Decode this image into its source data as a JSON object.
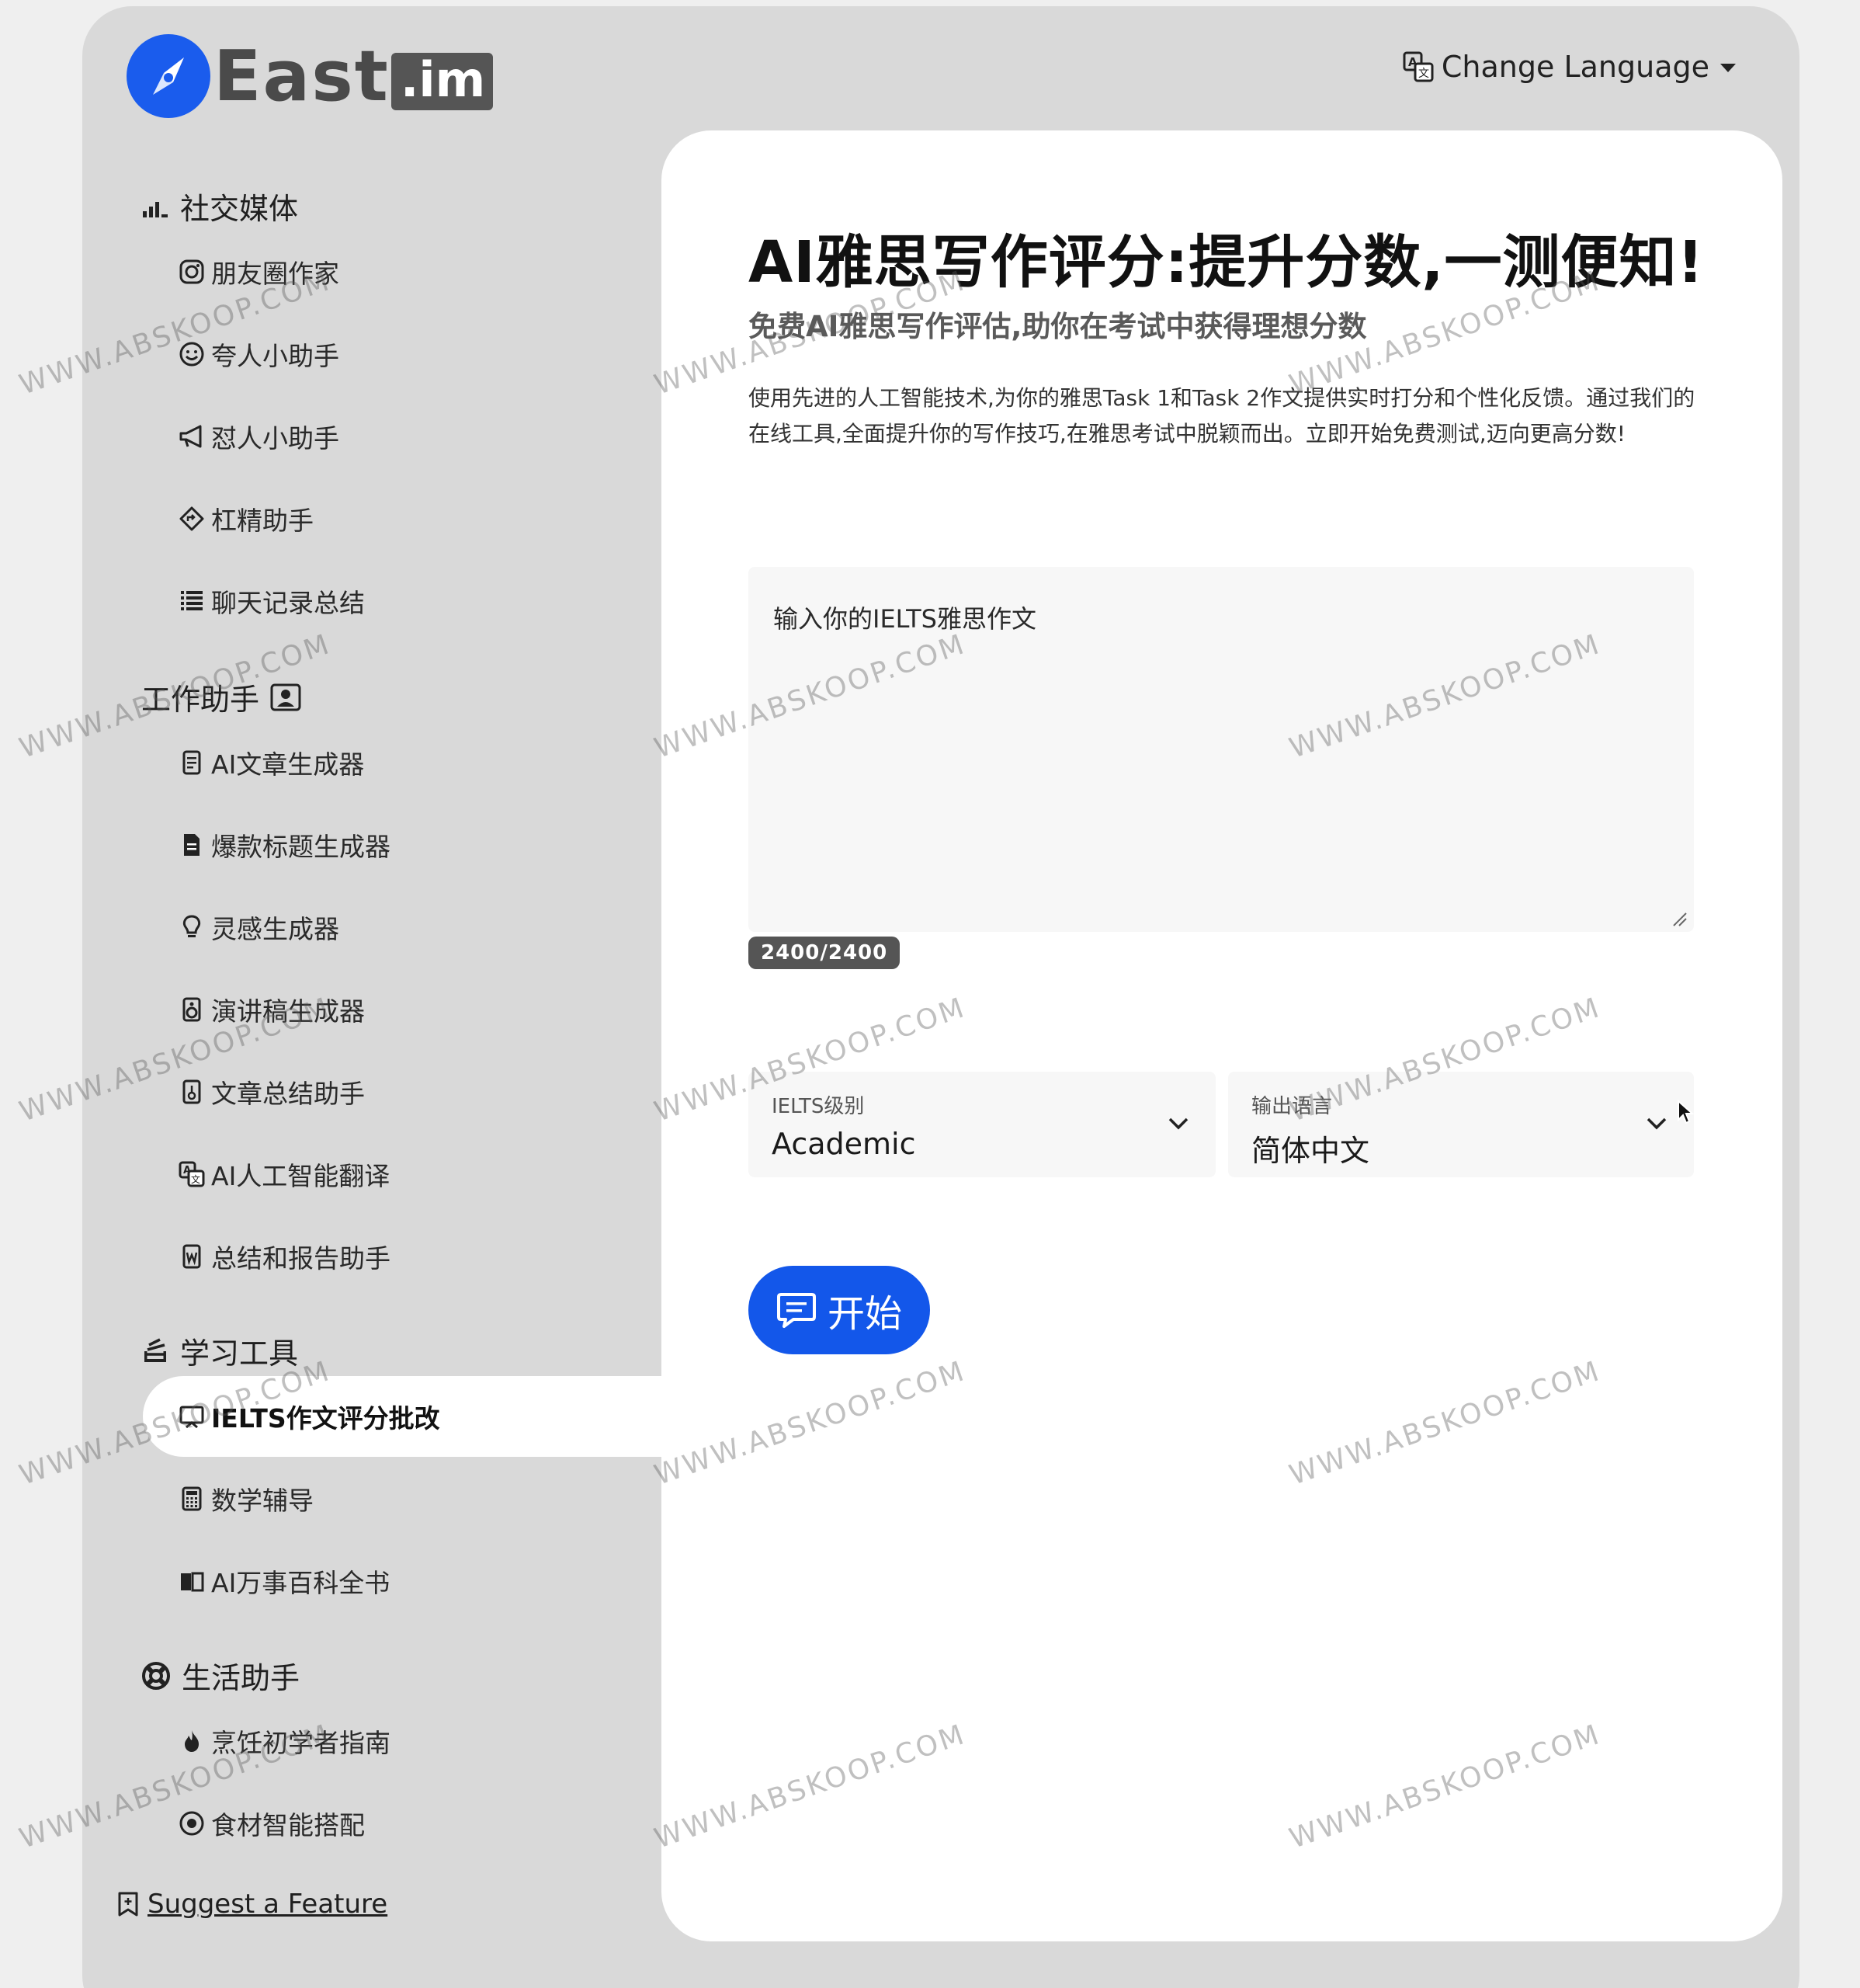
{
  "brand": {
    "name": "East",
    "suffix": ".im"
  },
  "header": {
    "change_language": "Change Language"
  },
  "sidebar": {
    "sections": [
      {
        "title": "社交媒体",
        "items": [
          "朋友圈作家",
          "夸人小助手",
          "怼人小助手",
          "杠精助手",
          "聊天记录总结"
        ]
      },
      {
        "title": "工作助手",
        "items": [
          "AI文章生成器",
          "爆款标题生成器",
          "灵感生成器",
          "演讲稿生成器",
          "文章总结助手",
          "AI人工智能翻译",
          "总结和报告助手"
        ]
      },
      {
        "title": "学习工具",
        "items": [
          "IELTS作文评分批改",
          "数学辅导",
          "AI万事百科全书"
        ]
      },
      {
        "title": "生活助手",
        "items": [
          "烹饪初学者指南",
          "食材智能搭配"
        ]
      }
    ],
    "active_item": "IELTS作文评分批改",
    "suggest": "Suggest a Feature"
  },
  "main": {
    "title": "AI雅思写作评分:提升分数,一测便知!",
    "subtitle": "免费AI雅思写作评估,助你在考试中获得理想分数",
    "description": "使用先进的人工智能技术,为你的雅思Task 1和Task 2作文提供实时打分和个性化反馈。通过我们的在线工具,全面提升你的写作技巧,在雅思考试中脱颖而出。立即开始免费测试,迈向更高分数!",
    "essay_placeholder": "输入你的IELTS雅思作文",
    "char_counter": "2400/2400",
    "ielts_level": {
      "label": "IELTS级别",
      "value": "Academic"
    },
    "output_language": {
      "label": "输出语言",
      "value": "简体中文"
    },
    "start_button": "开始"
  },
  "watermark": "WWW.ABSKOOP.COM",
  "colors": {
    "accent": "#1357ea",
    "logo": "#1a5ced",
    "sidebar_bg": "#d9d9d9",
    "page_bg": "#efefef"
  }
}
